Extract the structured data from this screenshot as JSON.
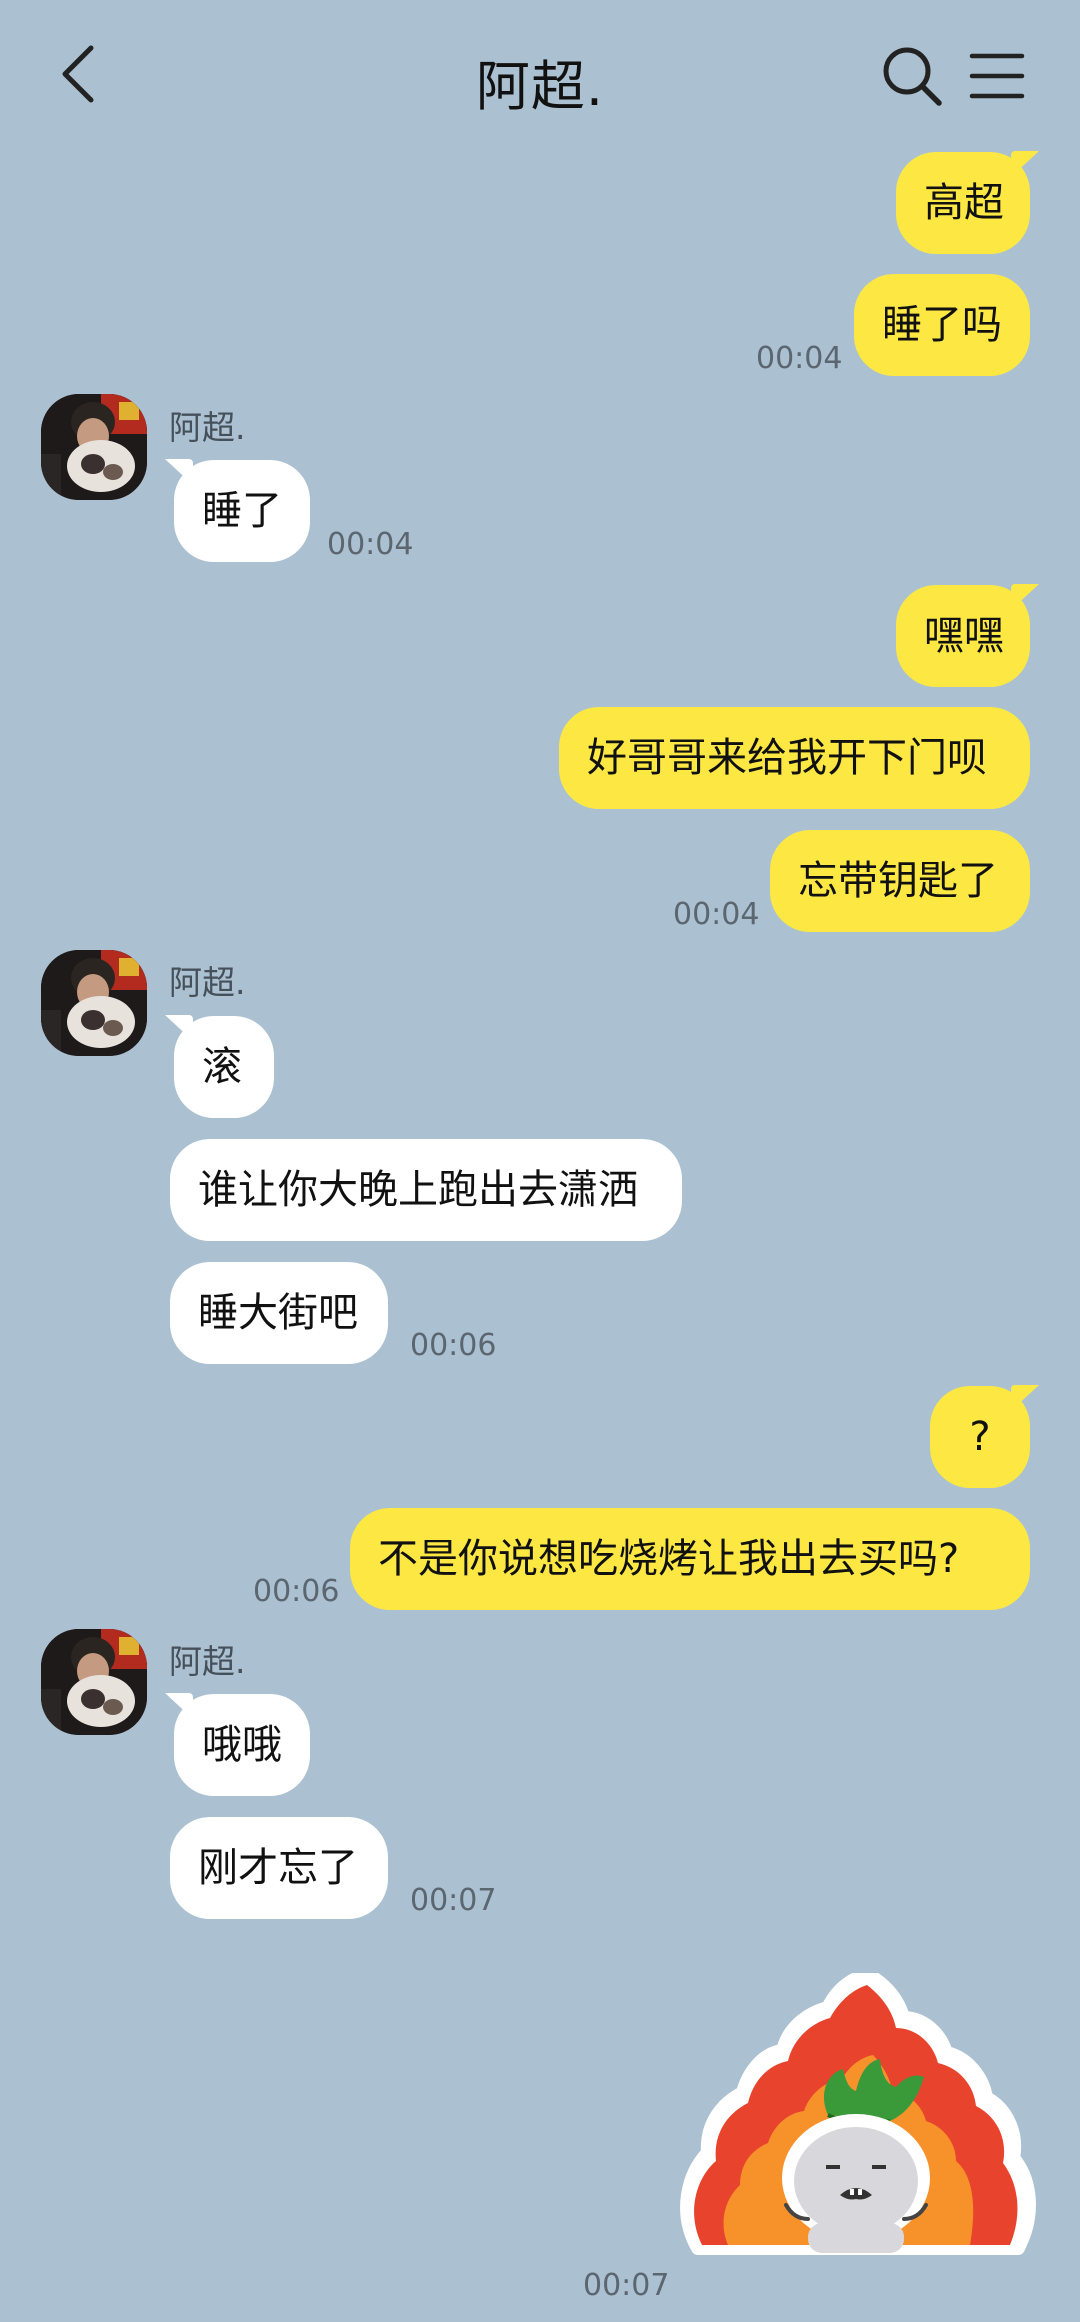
{
  "header": {
    "title": "阿超.",
    "back_icon": "chevron-left-icon",
    "search_icon": "search-icon",
    "menu_icon": "menu-icon"
  },
  "theme": {
    "background": "#abc1d1",
    "my_bubble": "#fde843",
    "other_bubble": "#ffffff"
  },
  "messages": {
    "m1": "高超",
    "m2": "睡了吗",
    "t1": "00:04",
    "s1": "阿超.",
    "m3": "睡了",
    "t2": "00:04",
    "m4": "嘿嘿",
    "m5": "好哥哥来给我开下门呗",
    "m6": "忘带钥匙了",
    "t3": "00:04",
    "s2": "阿超.",
    "m7": "滚",
    "m8": "谁让你大晚上跑出去潇洒",
    "m9": "睡大街吧",
    "t4": "00:06",
    "m10": "?",
    "m11": "不是你说想吃烧烤让我出去买吗?",
    "t5": "00:06",
    "s3": "阿超.",
    "m12": "哦哦",
    "m13": "刚才忘了",
    "t6": "00:07",
    "sticker_icon": "angry-flame-sticker-icon",
    "t7": "00:07"
  }
}
